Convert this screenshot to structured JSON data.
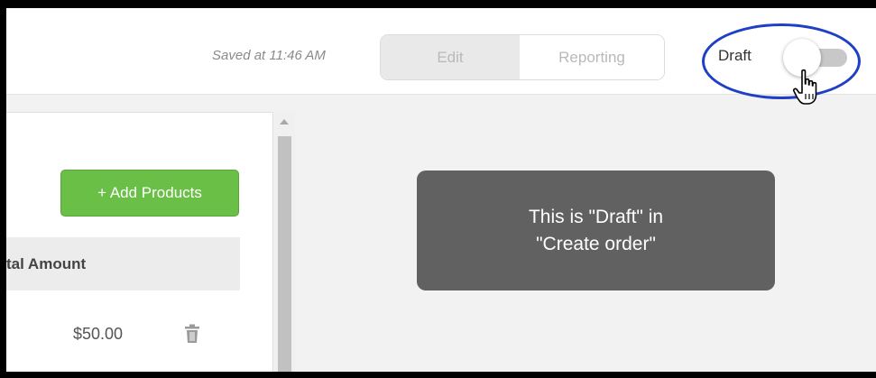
{
  "header": {
    "saved_text": "Saved at 11:46 AM",
    "tabs": [
      {
        "label": "Edit",
        "active": true
      },
      {
        "label": "Reporting",
        "active": false
      }
    ],
    "draft_label": "Draft",
    "draft_toggle_on": false
  },
  "panel": {
    "add_products_label": "+ Add Products",
    "column_header": "tal Amount",
    "row_amount": "$50.00"
  },
  "tooltip": {
    "line1": "This is \"Draft\" in",
    "line2": "\"Create order\""
  },
  "colors": {
    "add_button": "#6abf47",
    "annotation_circle": "#1f3fc4",
    "tooltip_bg": "#616161"
  }
}
